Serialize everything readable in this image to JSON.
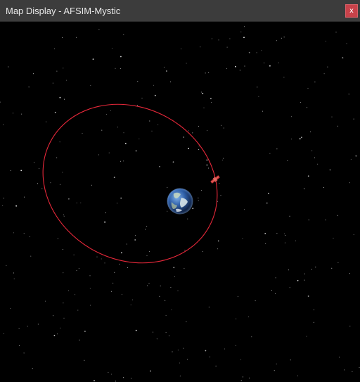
{
  "window": {
    "title": "Map Display - AFSIM-Mystic",
    "close_label": "x"
  },
  "scene": {
    "background": "#000000",
    "orbit_color": "#e8283a",
    "satellite_color": "#d23a3a",
    "body_icon": "earth-icon",
    "object_icon": "satellite-icon"
  }
}
